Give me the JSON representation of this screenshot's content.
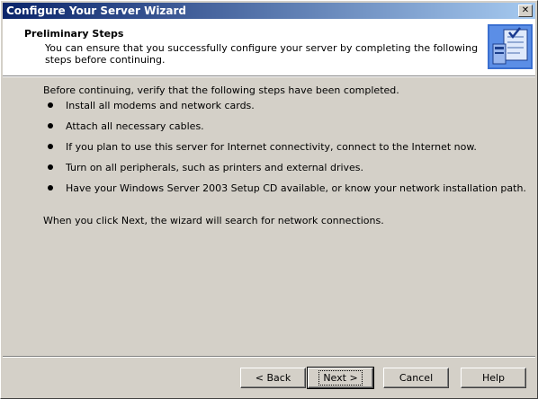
{
  "window": {
    "title": "Configure Your Server Wizard",
    "close_glyph": "✕"
  },
  "header": {
    "title": "Preliminary Steps",
    "description": "You can ensure that you successfully configure your server by completing the following steps before continuing.",
    "icon": "wizard-checklist-icon"
  },
  "body": {
    "intro": "Before continuing, verify that the following steps have been completed.",
    "steps": [
      "Install all modems and network cards.",
      "Attach all necessary cables.",
      "If you plan to use this server for Internet connectivity, connect to the Internet now.",
      "Turn on all peripherals, such as printers and external drives.",
      "Have your Windows Server 2003 Setup CD available, or know your network installation path."
    ],
    "outro": "When you click Next, the wizard will search for network connections."
  },
  "buttons": {
    "back": "< Back",
    "next": "Next >",
    "cancel": "Cancel",
    "help": "Help"
  },
  "colors": {
    "titlebar_start": "#0a246a",
    "titlebar_end": "#a6caf0",
    "face": "#d4d0c8"
  }
}
